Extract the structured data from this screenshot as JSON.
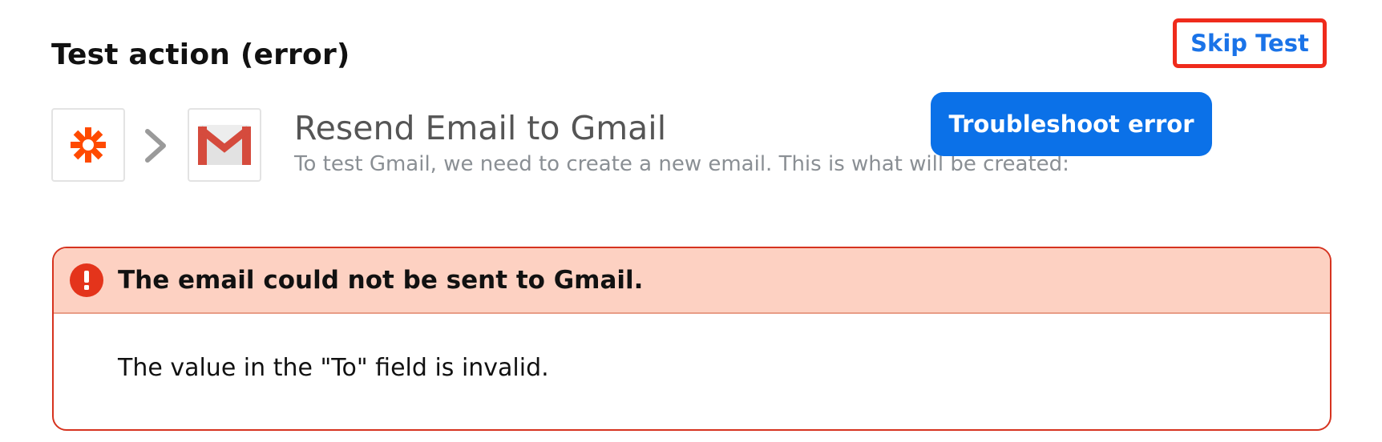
{
  "header": {
    "title": "Test action (error)",
    "skip_button_label": "Skip Test"
  },
  "action": {
    "title": "Resend Email to Gmail",
    "description": "To test Gmail, we need to create a new email. This is what will be created:",
    "trigger_app_icon": "zapier-asterisk-icon",
    "action_app_icon": "gmail-icon"
  },
  "error": {
    "heading": "The email could not be sent to Gmail.",
    "message": "The value in the \"To\" field is invalid.",
    "troubleshoot_button_label": "Troubleshoot error",
    "icon": "exclamation-icon"
  },
  "colors": {
    "highlight_border": "#ef2b1c",
    "link_blue": "#1a73e8",
    "error_bg": "#fdd1c2",
    "error_border": "#d6331f",
    "button_blue": "#0b71e8",
    "zapier_orange": "#ff4a00"
  }
}
